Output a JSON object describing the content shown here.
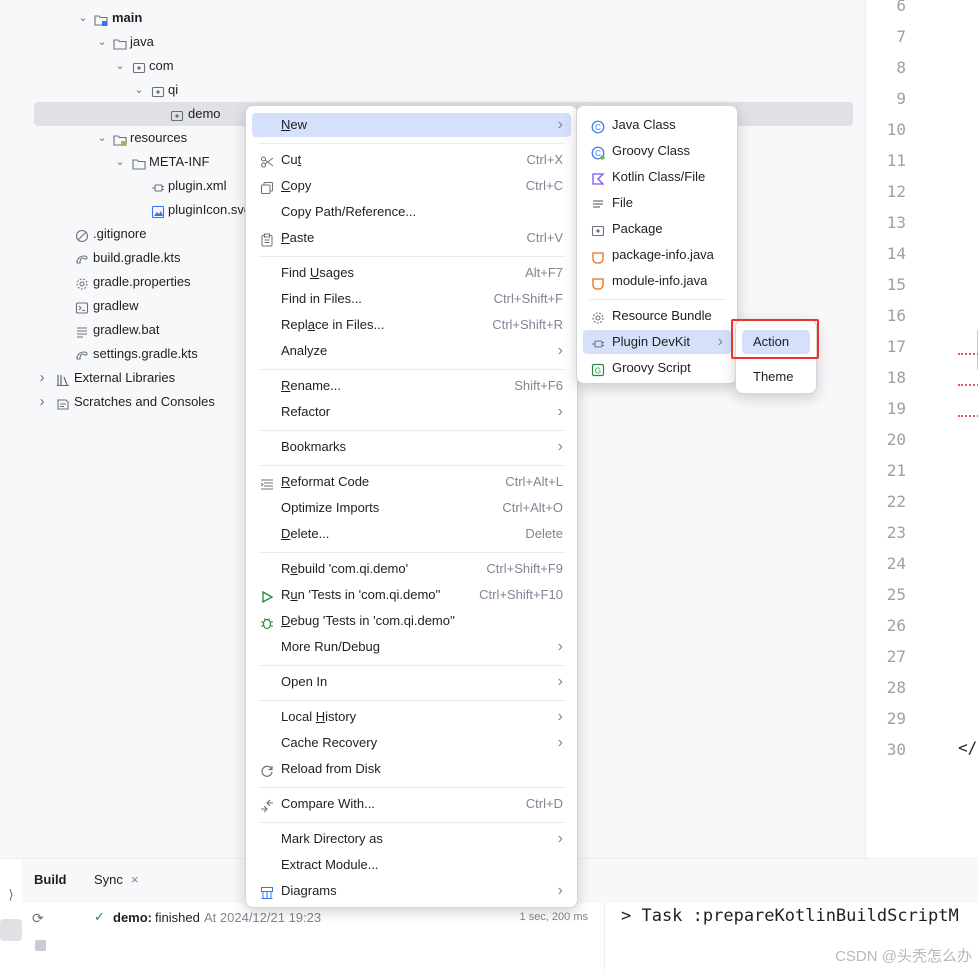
{
  "project_tree": {
    "rows": [
      {
        "label": "main",
        "bold": true,
        "expanded": true,
        "icon": "source-folder-icon"
      },
      {
        "label": "java",
        "expanded": true,
        "icon": "folder-icon"
      },
      {
        "label": "com",
        "expanded": true,
        "icon": "package-icon"
      },
      {
        "label": "qi",
        "expanded": true,
        "icon": "package-icon"
      },
      {
        "label": "demo",
        "icon": "package-icon",
        "selected": true
      },
      {
        "label": "resources",
        "expanded": true,
        "icon": "resources-folder-icon"
      },
      {
        "label": "META-INF",
        "expanded": true,
        "icon": "folder-icon"
      },
      {
        "label": "plugin.xml",
        "icon": "plugin-icon"
      },
      {
        "label": "pluginIcon.svg",
        "icon": "image-icon"
      },
      {
        "label": ".gitignore",
        "icon": "ignore-icon"
      },
      {
        "label": "build.gradle.kts",
        "icon": "gradle-icon"
      },
      {
        "label": "gradle.properties",
        "icon": "gear-icon"
      },
      {
        "label": "gradlew",
        "icon": "terminal-icon"
      },
      {
        "label": "gradlew.bat",
        "icon": "text-file-icon"
      },
      {
        "label": "settings.gradle.kts",
        "icon": "gradle-icon"
      },
      {
        "label": "External Libraries",
        "expanded": false,
        "icon": "library-icon"
      },
      {
        "label": "Scratches and Consoles",
        "expanded": false,
        "icon": "scratches-icon"
      }
    ]
  },
  "editor": {
    "line_numbers": [
      "6",
      "7",
      "8",
      "9",
      "10",
      "11",
      "12",
      "13",
      "14",
      "15",
      "16",
      "17",
      "18",
      "19",
      "20",
      "21",
      "22",
      "23",
      "24",
      "25",
      "26",
      "27",
      "28",
      "29",
      "30"
    ],
    "code_fragment": "</"
  },
  "context_menu": {
    "items": [
      {
        "label": "New",
        "mnemonic": "N",
        "submenu": true,
        "highlighted": true
      },
      {
        "separator": true
      },
      {
        "label": "Cut",
        "mnemonic": "t",
        "shortcut": "Ctrl+X",
        "icon": "scissors-icon"
      },
      {
        "label": "Copy",
        "mnemonic": "C",
        "shortcut": "Ctrl+C",
        "icon": "copy-icon"
      },
      {
        "label": "Copy Path/Reference..."
      },
      {
        "label": "Paste",
        "mnemonic": "P",
        "shortcut": "Ctrl+V",
        "icon": "paste-icon"
      },
      {
        "separator": true
      },
      {
        "label": "Find Usages",
        "mnemonic": "U",
        "shortcut": "Alt+F7"
      },
      {
        "label": "Find in Files...",
        "shortcut": "Ctrl+Shift+F"
      },
      {
        "label": "Replace in Files...",
        "mnemonic": "a",
        "shortcut": "Ctrl+Shift+R"
      },
      {
        "label": "Analyze",
        "submenu": true
      },
      {
        "separator": true
      },
      {
        "label": "Rename...",
        "mnemonic": "R",
        "shortcut": "Shift+F6"
      },
      {
        "label": "Refactor",
        "submenu": true
      },
      {
        "separator": true
      },
      {
        "label": "Bookmarks",
        "submenu": true
      },
      {
        "separator": true
      },
      {
        "label": "Reformat Code",
        "mnemonic": "R",
        "shortcut": "Ctrl+Alt+L",
        "icon": "reformat-icon"
      },
      {
        "label": "Optimize Imports",
        "shortcut": "Ctrl+Alt+O"
      },
      {
        "label": "Delete...",
        "mnemonic": "D",
        "shortcut": "Delete"
      },
      {
        "separator": true
      },
      {
        "label": "Rebuild 'com.qi.demo'",
        "mnemonic": "e",
        "shortcut": "Ctrl+Shift+F9"
      },
      {
        "label": "Run 'Tests in 'com.qi.demo''",
        "mnemonic": "u",
        "shortcut": "Ctrl+Shift+F10",
        "icon": "run-icon"
      },
      {
        "label": "Debug 'Tests in 'com.qi.demo''",
        "mnemonic": "D",
        "icon": "debug-icon"
      },
      {
        "label": "More Run/Debug",
        "submenu": true
      },
      {
        "separator": true
      },
      {
        "label": "Open In",
        "submenu": true
      },
      {
        "separator": true
      },
      {
        "label": "Local History",
        "mnemonic": "H",
        "submenu": true
      },
      {
        "label": "Cache Recovery",
        "submenu": true
      },
      {
        "label": "Reload from Disk",
        "icon": "reload-icon"
      },
      {
        "separator": true
      },
      {
        "label": "Compare With...",
        "shortcut": "Ctrl+D",
        "icon": "compare-icon"
      },
      {
        "separator": true
      },
      {
        "label": "Mark Directory as",
        "submenu": true
      },
      {
        "label": "Extract Module..."
      },
      {
        "label": "Diagrams",
        "submenu": true,
        "icon": "diagram-icon"
      }
    ]
  },
  "new_submenu": {
    "items": [
      {
        "label": "Java Class",
        "icon": "java-class-icon"
      },
      {
        "label": "Groovy Class",
        "icon": "groovy-class-icon"
      },
      {
        "label": "Kotlin Class/File",
        "icon": "kotlin-icon"
      },
      {
        "label": "File",
        "icon": "file-icon"
      },
      {
        "label": "Package",
        "icon": "package-icon"
      },
      {
        "label": "package-info.java",
        "icon": "java-file-icon"
      },
      {
        "label": "module-info.java",
        "icon": "java-file-icon"
      },
      {
        "separator": true
      },
      {
        "label": "Resource Bundle",
        "icon": "gear-icon"
      },
      {
        "label": "Plugin DevKit",
        "icon": "plugin-icon",
        "submenu": true,
        "highlighted": true
      },
      {
        "label": "Groovy Script",
        "icon": "groovy-script-icon"
      }
    ]
  },
  "devkit_submenu": {
    "items": [
      {
        "label": "Action",
        "highlighted": true
      },
      {
        "label": "Theme"
      }
    ]
  },
  "build_panel": {
    "tabs": [
      {
        "label": "Build",
        "active": true
      },
      {
        "label": "Sync",
        "closable": true
      }
    ],
    "task": {
      "name": "demo:",
      "status": "finished",
      "timestamp": "At 2024/12/21 19:23",
      "duration": "1 sec, 200 ms"
    },
    "console_line": "> Task :prepareKotlinBuildScriptM"
  },
  "watermark": "CSDN @头秃怎么办",
  "colors": {
    "highlight": "#d5e1fb",
    "selected_row": "#dfe1e5",
    "callout": "#e8342b",
    "success": "#208a3c"
  }
}
